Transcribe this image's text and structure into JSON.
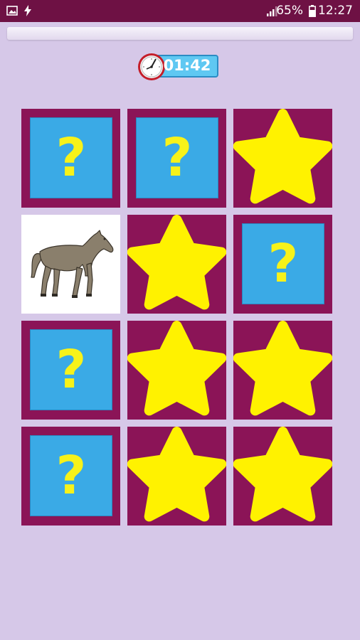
{
  "status_bar": {
    "battery_percent": "65%",
    "time": "12:27",
    "icons": [
      "image-icon",
      "flash-icon",
      "signal-icon",
      "battery-icon"
    ]
  },
  "game": {
    "timer": "01:42",
    "columns": 3,
    "rows": 4,
    "cards": [
      {
        "state": "hidden",
        "symbol": "?"
      },
      {
        "state": "hidden",
        "symbol": "?"
      },
      {
        "state": "matched",
        "symbol": "star"
      },
      {
        "state": "revealed",
        "symbol": "horse"
      },
      {
        "state": "matched",
        "symbol": "star"
      },
      {
        "state": "hidden",
        "symbol": "?"
      },
      {
        "state": "hidden",
        "symbol": "?"
      },
      {
        "state": "matched",
        "symbol": "star"
      },
      {
        "state": "matched",
        "symbol": "star"
      },
      {
        "state": "hidden",
        "symbol": "?"
      },
      {
        "state": "matched",
        "symbol": "star"
      },
      {
        "state": "matched",
        "symbol": "star"
      }
    ]
  },
  "colors": {
    "background": "#d6c8e8",
    "status_bar": "#6e1144",
    "card_back": "#8b1457",
    "question_tile": "#3aaae6",
    "question_mark": "#f7f21a",
    "star": "#fff200",
    "timer_box": "#5fc8f2"
  }
}
